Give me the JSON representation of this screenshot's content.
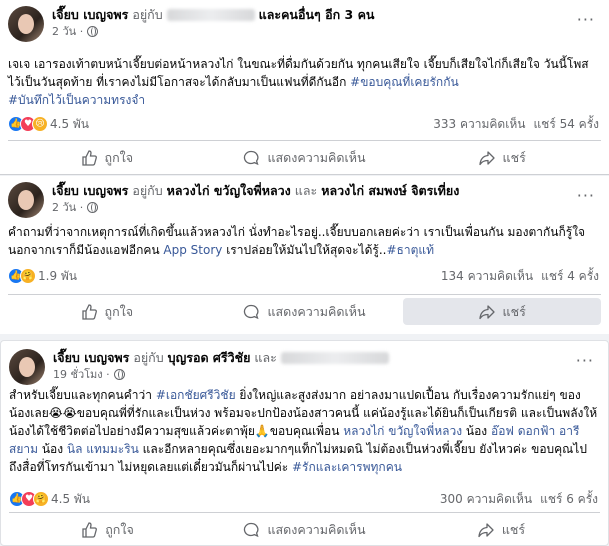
{
  "posts": [
    {
      "author": "เจี๊ยบ เบญจพร",
      "with_prefix": "อยู่กับ",
      "with_suffix": "และคนอื่นๆ อีก 3 คน",
      "time": "2 วัน ·",
      "text_a": "เจเจ เอารองเท้าตบหน้าเจี๊ยบต่อหน้าหลวงไก่ ในขณะที่ดื่มกันด้วยกัน ทุกคนเสียใจ เจี๊ยบก็เสียใจไก่ก็เสียใจ วันนี้โพสไว้เป็นวันสุดท้าย ที่เราคงไม่มีโอกาสจะได้กลับมาเป็นแฟนที่ดีกันอีก ",
      "tag1": "#ขอบคุณที่เคยรักกัน",
      "tag2": "#บันทึกไว้เป็นความทรงจำ",
      "reactions_count": "4.5 พัน",
      "comments": "333 ความคิดเห็น",
      "shares": "แชร์ 54 ครั้ง"
    },
    {
      "author": "เจี๊ยบ เบญจพร",
      "with_prefix": "อยู่กับ",
      "with1": "หลวงไก่ ขวัญใจพี่หลวง",
      "and": "และ",
      "with2": "หลวงไก่ สมพงษ์ จิตรเที่ยง",
      "time": "2 วัน ·",
      "text_a": "คำถามที่ว่าจากเหตุการณ์ที่เกิดขึ้นแล้วหลวงไก่ นั่งทำอะไรอยู่..เจี๊ยบบอกเลยค่ะว่า เราเป็นเพื่อนกัน มองตากันก็รู้ใจ นอกจากเราก็มีน้องแอฟอีกคน ",
      "app": "App Story",
      "text_b": " เราปล่อยให้มันไปให้สุดจะได้รู้..",
      "tag1": "#ธาตุแท้",
      "reactions_count": "1.9 พัน",
      "comments": "134 ความคิดเห็น",
      "shares": "แชร์ 4 ครั้ง"
    },
    {
      "author": "เจี๊ยบ เบญจพร",
      "with_prefix": "อยู่กับ",
      "with1": "บุญรอด ศรีวิชัย",
      "and": "และ",
      "time": "19 ชั่วโมง ·",
      "text_a": "สำหรับเจี๊ยบและทุกคนคำว่า ",
      "tag1": "#เอกชัยศรีวิชัย",
      "text_b": " ยิ่งใหญ่และสูงส่งมาก อย่าลงมาแปดเปื้อน กับเรื่องความรักแย่ๆ ของน้องเลย😭😭ขอบคุณพี่ที่รักและเป็นห่วง พร้อมจะปกป้องน้องสาวคนนี้ แค่น้องรู้และได้ยินก็เป็นเกียรติ และเป็นพลังให้น้องได้ใช้ชีวิตต่อไปอย่างมีความสุขแล้วค่ะตาพุ้ย🙏ขอบคุณเพื่อน ",
      "m1": "หลวงไก่ ขวัญใจพี่หลวง",
      "text_c": " น้อง ",
      "m2": "อ๊อฟ ดอกฟ้า อารีสยาม",
      "text_d": " น้อง ",
      "m3": "นิล แทมมะริน",
      "text_e": " และอีกหลายคุณซึ่งเยอะมากๆแท็กไม่หมดนิ ไม่ต้องเป็นห่วงพี่เจี๊ยบ ยังไหวค่ะ ขอบคุณไปถึงสื่อที่โทรกันเข้ามา ไม่หยุดเลยแต่เดี๋ยวมันก็ผ่านไปค่ะ ",
      "tag2": "#รักและเคารพทุกคน",
      "reactions_count": "4.5 พัน",
      "comments": "300 ความคิดเห็น",
      "shares": "แชร์ 6 ครั้ง"
    }
  ],
  "actions": {
    "like": "ถูกใจ",
    "comment": "แสดงความคิดเห็น",
    "share": "แชร์"
  },
  "more": "···",
  "icons": [
    "like-thumb-icon",
    "comment-bubble-icon",
    "share-arrow-icon",
    "globe-icon"
  ],
  "colors": {
    "link": "#385898",
    "accent": "#1877f2",
    "muted": "#65676b"
  }
}
